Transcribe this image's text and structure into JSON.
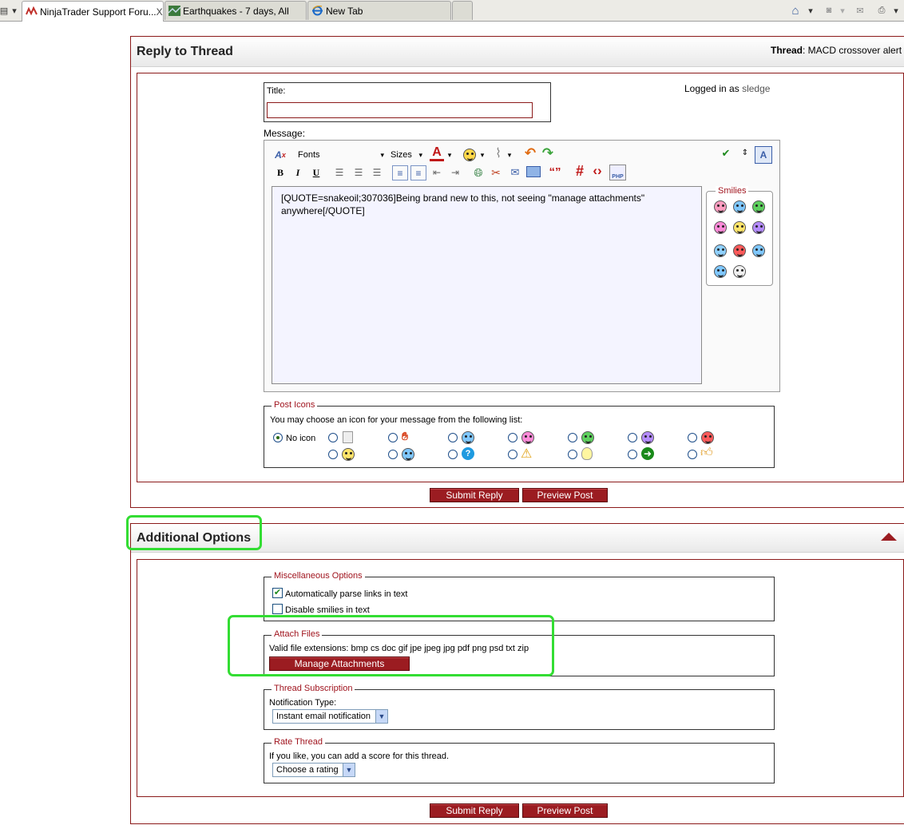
{
  "browser": {
    "tabs": [
      {
        "label": "NinjaTrader Support Foru...",
        "active": true,
        "close": "X"
      },
      {
        "label": "Earthquakes - 7 days, All",
        "active": false
      },
      {
        "label": "New Tab",
        "active": false
      }
    ]
  },
  "reply_panel": {
    "title": "Reply to Thread",
    "thread_label": "Thread",
    "thread_name": ": MACD crossover alert",
    "title_label": "Title:",
    "title_value": "",
    "logged_in_prefix": "Logged in as",
    "username": "sledge",
    "message_label": "Message:",
    "toolbar": {
      "fonts": "Fonts",
      "sizes": "Sizes"
    },
    "message_text": "[QUOTE=snakeoil;307036]Being brand new to this, not seeing \"manage attachments\" anywhere[/QUOTE]",
    "smilies_label": "Smilies",
    "post_icons": {
      "legend": "Post Icons",
      "description": "You may choose an icon for your message from the following list:",
      "no_icon_label": "No icon"
    },
    "submit_label": "Submit Reply",
    "preview_label": "Preview Post"
  },
  "options_panel": {
    "title": "Additional Options",
    "misc": {
      "legend": "Miscellaneous Options",
      "parse_links_label": "Automatically parse links in text",
      "parse_links_checked": true,
      "disable_smilies_label": "Disable smilies in text",
      "disable_smilies_checked": false
    },
    "attach": {
      "legend": "Attach Files",
      "extensions_text": "Valid file extensions: bmp cs doc gif jpe jpeg jpg pdf png psd txt zip",
      "manage_label": "Manage Attachments"
    },
    "subscription": {
      "legend": "Thread Subscription",
      "type_label": "Notification Type:",
      "selected": "Instant email notification"
    },
    "rate": {
      "legend": "Rate Thread",
      "description": "If you like, you can add a score for this thread.",
      "selected": "Choose a rating"
    },
    "submit_label": "Submit Reply",
    "preview_label": "Preview Post"
  },
  "colors": {
    "brand_red": "#9b1c21",
    "highlight_green": "#33dd33",
    "editor_bg": "#f4f4ff"
  }
}
